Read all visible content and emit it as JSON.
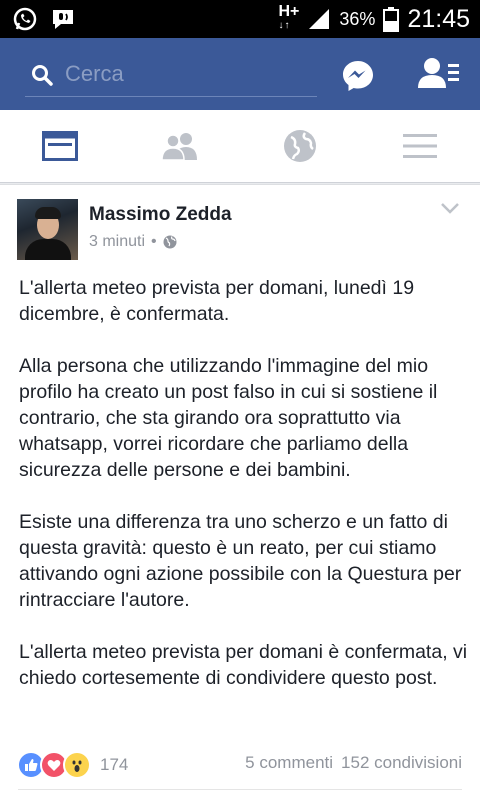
{
  "status_bar": {
    "network": "H+",
    "battery": "36%",
    "time": "21:45"
  },
  "header": {
    "search_placeholder": "Cerca"
  },
  "post": {
    "author": "Massimo Zedda",
    "time": "3 minuti",
    "privacy_icon": "globe-icon",
    "paragraphs": [
      "L'allerta meteo prevista per domani, lunedì 19 dicembre, è confermata.",
      "Alla persona che utilizzando l'immagine del mio profilo ha creato un post falso in cui si sostiene il contrario, che sta girando ora soprattutto via whatsapp, vorrei ricordare che parliamo della sicurezza delle persone e dei bambini.",
      "Esiste una differenza tra uno scherzo e un fatto di questa gravità: questo è un reato, per cui stiamo attivando ogni azione possibile con la Questura per rintracciare l'autore.",
      "L'allerta meteo prevista per domani è confermata, vi chiedo cortesemente di condividere questo post."
    ],
    "reactions": [
      "like-icon",
      "love-icon",
      "wow-icon"
    ],
    "reaction_count": "174",
    "comments": "5 commenti",
    "shares": "152 condivisioni"
  },
  "colors": {
    "brand": "#3b5998",
    "text": "#1d2129",
    "muted": "#90949c"
  }
}
